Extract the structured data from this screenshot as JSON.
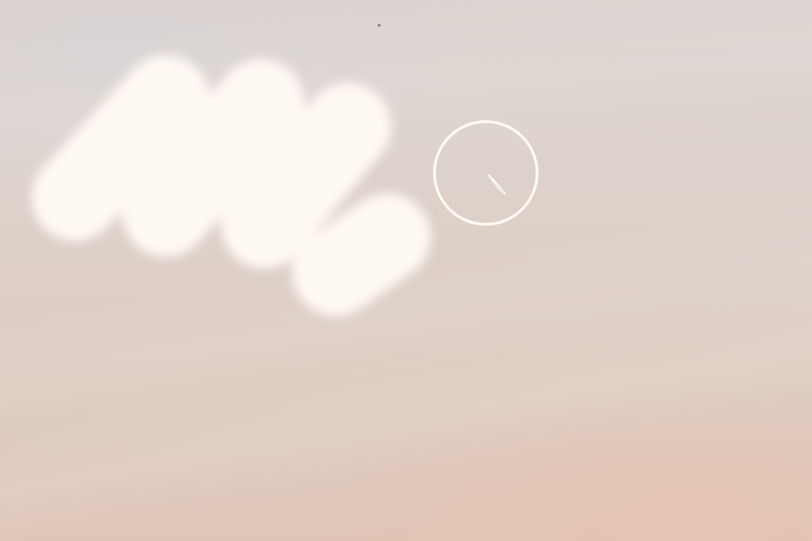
{
  "photo": {
    "subject": "bird",
    "colors": {
      "sky_top": "#dcd3cf",
      "sky_bottom": "#dfc5b6",
      "flare": "#fff8f2",
      "ring": "#fffaf2"
    }
  },
  "annotations": {
    "highlight_marker": {
      "shape": "circle",
      "icon": "circle-outline-icon"
    },
    "bird": {
      "icon": "bird-silhouette-icon"
    }
  }
}
